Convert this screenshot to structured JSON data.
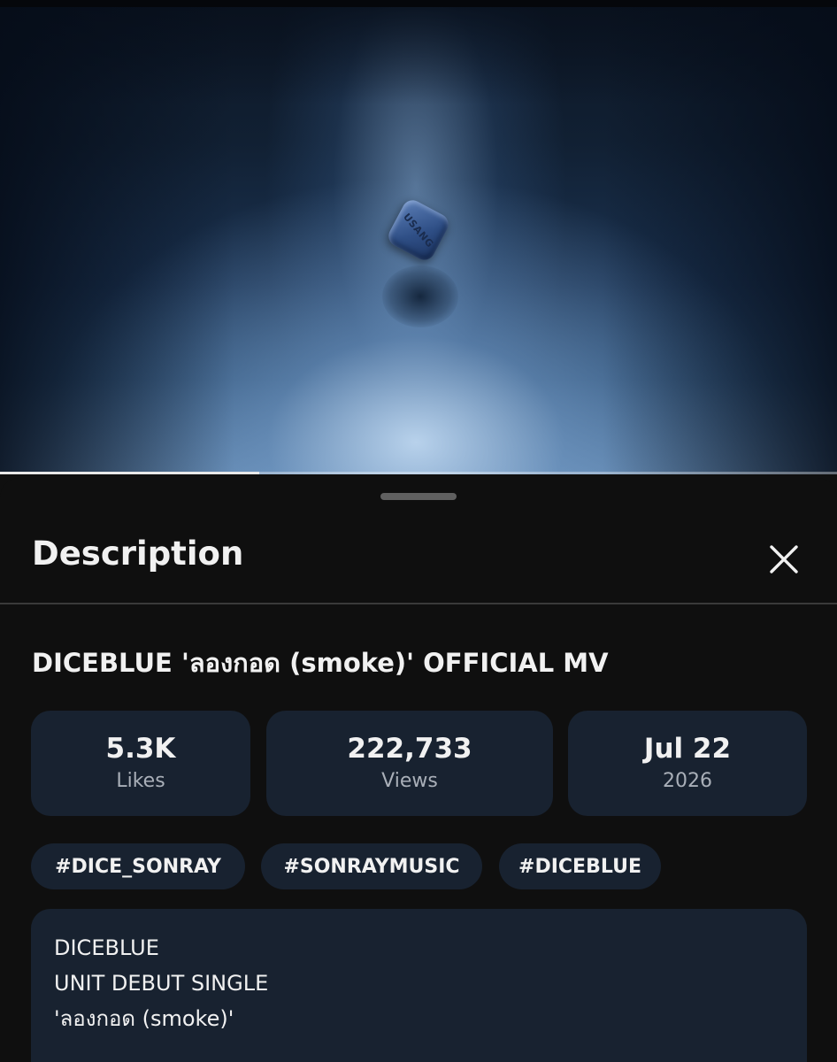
{
  "video": {
    "die_text": "USANG",
    "progress": 0.31
  },
  "sheet": {
    "title": "Description",
    "close_icon": "close-icon"
  },
  "video_info": {
    "title": "DICEBLUE 'ลองกอด (smoke)' OFFICIAL MV",
    "stats": [
      {
        "value": "5.3K",
        "label": "Likes"
      },
      {
        "value": "222,733",
        "label": "Views"
      },
      {
        "value": "Jul 22",
        "label": "2026"
      }
    ],
    "hashtags": [
      "#DICE_SONRAY",
      "#SONRAYMUSIC",
      "#DICEBLUE"
    ],
    "description_lines": [
      "DICEBLUE",
      "UNIT DEBUT SINGLE",
      "'ลองกอด (smoke)'"
    ]
  },
  "colors": {
    "background": "#0f0f0f",
    "card": "#182230",
    "text_primary": "#f1f1f1",
    "text_secondary": "#a9afb8"
  }
}
